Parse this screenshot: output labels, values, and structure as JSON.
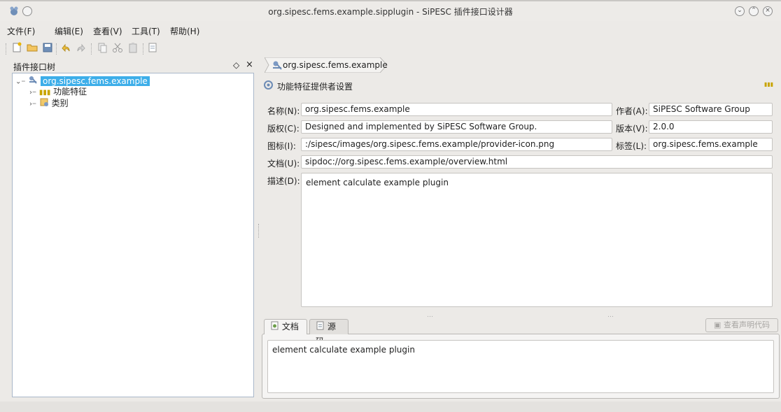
{
  "window": {
    "title": "org.sipesc.fems.example.sipplugin - SiPESC 插件接口设计器"
  },
  "menu": [
    "文件(F)",
    "编辑(E)",
    "查看(V)",
    "工具(T)",
    "帮助(H)"
  ],
  "left_panel": {
    "title": "插件接口树",
    "float_label": "◇",
    "close_label": "×",
    "tree": {
      "root": "org.sipesc.fems.example",
      "children": [
        "功能特征",
        "类别"
      ]
    }
  },
  "breadcrumb": "org.sipesc.fems.example",
  "section_title": "功能特征提供者设置",
  "form": {
    "name_label": "名称(N):",
    "name_value": "org.sipesc.fems.example",
    "author_label": "作者(A):",
    "author_value": "SiPESC Software Group",
    "copyright_label": "版权(C):",
    "copyright_value": "Designed and implemented by SiPESC Software Group.",
    "version_label": "版本(V):",
    "version_value": "2.0.0",
    "icon_label": "图标(I):",
    "icon_value": ":/sipesc/images/org.sipesc.fems.example/provider-icon.png",
    "tag_label": "标签(L):",
    "tag_value": "org.sipesc.fems.example",
    "doc_label": "文档(U):",
    "doc_value": "sipdoc://org.sipesc.fems.example/overview.html",
    "desc_label": "描述(D):",
    "desc_value": "element calculate example plugin"
  },
  "bottom_tabs": {
    "tab_doc": "文档",
    "tab_source": "源码",
    "view_code_button": "查看声明代码",
    "doc_content": "element calculate example plugin"
  },
  "colors": {
    "selection": "#3daee9",
    "accent_dot": "#c8a400"
  }
}
